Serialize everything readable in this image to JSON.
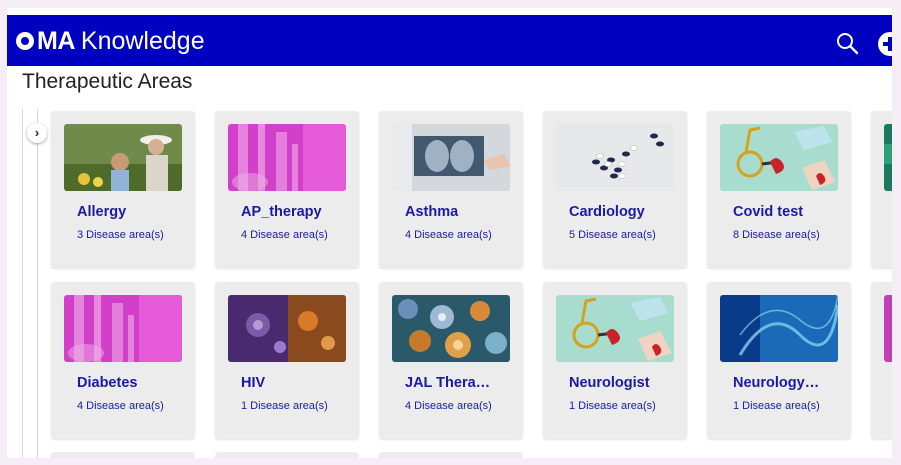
{
  "app": {
    "brand": "MA",
    "name": "Knowledge"
  },
  "page": {
    "title": "Therapeutic Areas"
  },
  "cards": [
    {
      "title": "Allergy",
      "count": "3 Disease area(s)"
    },
    {
      "title": "AP_therapy",
      "count": "4 Disease area(s)"
    },
    {
      "title": "Asthma",
      "count": "4 Disease area(s)"
    },
    {
      "title": "Cardiology",
      "count": "5 Disease area(s)"
    },
    {
      "title": "Covid test",
      "count": "8 Disease area(s)"
    },
    {
      "title": "Diabetes",
      "count": "4 Disease area(s)"
    },
    {
      "title": "HIV",
      "count": "1 Disease area(s)"
    },
    {
      "title": "JAL Thera…",
      "count": "4 Disease area(s)"
    },
    {
      "title": "Neurologist",
      "count": "1 Disease area(s)"
    },
    {
      "title": "Neurology…",
      "count": "1 Disease area(s)"
    }
  ],
  "icons": {
    "search": "search-icon",
    "add": "plus-circle-icon",
    "expand": "chevron-right-icon"
  },
  "colors": {
    "header": "#0000c0",
    "link": "#1a1aa6",
    "card": "#ececec"
  }
}
